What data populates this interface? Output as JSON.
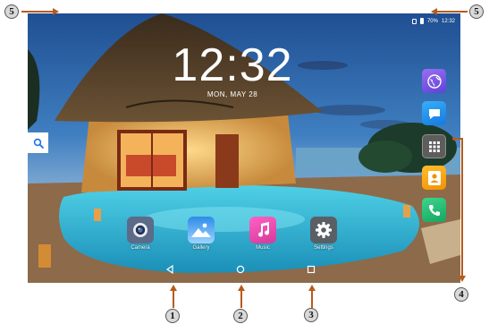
{
  "status_bar": {
    "battery_percent": "70%",
    "time": "12:32"
  },
  "lock_clock": {
    "time": "12:32",
    "date": "MON, MAY 28"
  },
  "side_widget": {
    "icon": "search-icon"
  },
  "dock": [
    {
      "icon": "globe-icon",
      "name": "browser"
    },
    {
      "icon": "message-bubble-icon",
      "name": "messages"
    },
    {
      "icon": "app-grid-icon",
      "name": "app-drawer"
    },
    {
      "icon": "contact-person-icon",
      "name": "contacts"
    },
    {
      "icon": "phone-handset-icon",
      "name": "phone"
    }
  ],
  "home_apps": [
    {
      "label": "Camera",
      "icon": "camera-icon"
    },
    {
      "label": "Gallery",
      "icon": "gallery-icon"
    },
    {
      "label": "Music",
      "icon": "music-note-icon"
    },
    {
      "label": "Settings",
      "icon": "gear-icon"
    }
  ],
  "nav_bar": [
    {
      "icon": "back-triangle-icon"
    },
    {
      "icon": "home-circle-icon"
    },
    {
      "icon": "recent-square-icon"
    }
  ],
  "callouts": [
    "1",
    "2",
    "3",
    "4",
    "5",
    "5"
  ],
  "colors": {
    "callout_arrow": "#b85a1b",
    "callout_fill": "#d9d9d9",
    "status_text": "#ffffff"
  }
}
